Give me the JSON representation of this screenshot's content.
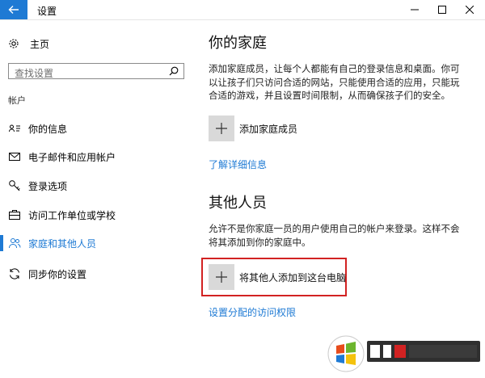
{
  "window": {
    "title": "设置"
  },
  "sidebar": {
    "home_label": "主页",
    "search_placeholder": "查找设置",
    "section_label": "帐户",
    "items": [
      {
        "label": "你的信息",
        "icon": "person-card-icon"
      },
      {
        "label": "电子邮件和应用帐户",
        "icon": "mail-icon"
      },
      {
        "label": "登录选项",
        "icon": "key-icon"
      },
      {
        "label": "访问工作单位或学校",
        "icon": "briefcase-icon"
      },
      {
        "label": "家庭和其他人员",
        "icon": "people-icon",
        "active": true
      },
      {
        "label": "同步你的设置",
        "icon": "sync-icon"
      }
    ]
  },
  "main": {
    "family": {
      "title": "你的家庭",
      "description": "添加家庭成员，让每个人都能有自己的登录信息和桌面。你可以让孩子们只访问合适的网站，只能使用合适的应用，只能玩合适的游戏，并且设置时间限制，从而确保孩子们的安全。",
      "add_label": "添加家庭成员",
      "link": "了解详细信息"
    },
    "others": {
      "title": "其他人员",
      "description": "允许不是你家庭一员的用户使用自己的帐户来登录。这样不会将其添加到你的家庭中。",
      "add_label": "将其他人添加到这台电脑",
      "link": "设置分配的访问权限"
    }
  },
  "colors": {
    "accent": "#1e7ad4",
    "highlight": "#d22222"
  }
}
